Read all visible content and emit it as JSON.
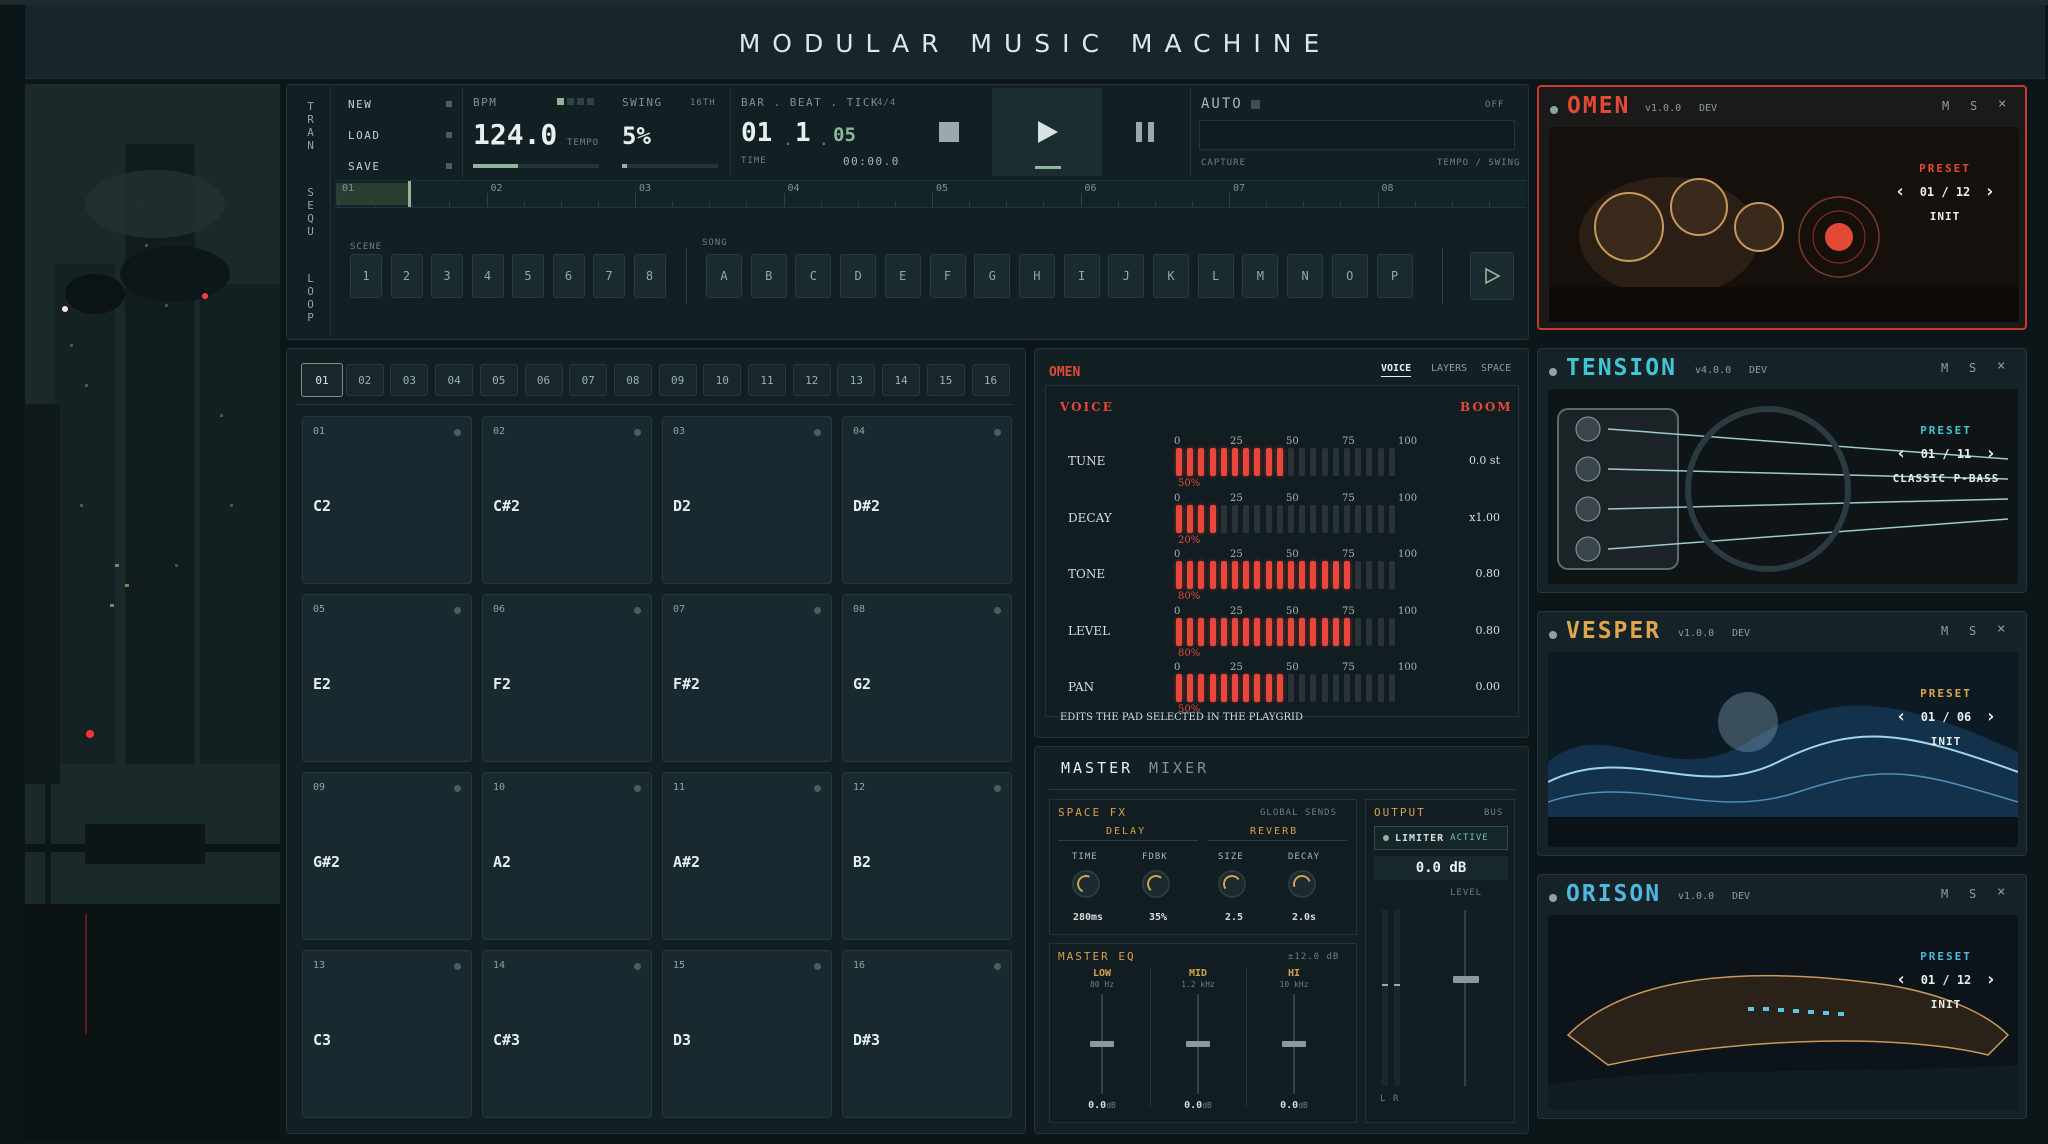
{
  "app": {
    "title": "MODULAR MUSIC MACHINE"
  },
  "side_labels": {
    "tran": "TRAN",
    "sequ": "SEQU",
    "loop": "LOOP"
  },
  "file_menu": [
    {
      "label": "NEW"
    },
    {
      "label": "LOAD"
    },
    {
      "label": "SAVE"
    }
  ],
  "tempo": {
    "label": "BPM",
    "value": "124.0",
    "sub_label": "TEMPO",
    "level": 0.36
  },
  "swing": {
    "label": "SWING",
    "division": "16TH",
    "value": "5%",
    "level": 0.05
  },
  "position": {
    "label": "BAR . BEAT . TICK",
    "signature": "4/4",
    "bar": "01",
    "beat": "1",
    "tick": "05",
    "time_label": "TIME",
    "time_value": "00:00.0"
  },
  "auto": {
    "label": "AUTO",
    "state": "OFF",
    "capture_label": "CAPTURE",
    "mode_label": "TEMPO / SWING"
  },
  "sequence_bars": [
    "01",
    "02",
    "03",
    "04",
    "05",
    "06",
    "07",
    "08"
  ],
  "scene": {
    "label": "SCENE",
    "items": [
      "1",
      "2",
      "3",
      "4",
      "5",
      "6",
      "7",
      "8"
    ]
  },
  "song": {
    "label": "SONG",
    "items": [
      "A",
      "B",
      "C",
      "D",
      "E",
      "F",
      "G",
      "H",
      "I",
      "J",
      "K",
      "L",
      "M",
      "N",
      "O",
      "P"
    ]
  },
  "pattern_tabs": [
    "01",
    "02",
    "03",
    "04",
    "05",
    "06",
    "07",
    "08",
    "09",
    "10",
    "11",
    "12",
    "13",
    "14",
    "15",
    "16"
  ],
  "selected_pattern": "01",
  "pads": [
    {
      "num": "01",
      "note": "C2"
    },
    {
      "num": "02",
      "note": "C#2"
    },
    {
      "num": "03",
      "note": "D2"
    },
    {
      "num": "04",
      "note": "D#2"
    },
    {
      "num": "05",
      "note": "E2"
    },
    {
      "num": "06",
      "note": "F2"
    },
    {
      "num": "07",
      "note": "F#2"
    },
    {
      "num": "08",
      "note": "G2"
    },
    {
      "num": "09",
      "note": "G#2"
    },
    {
      "num": "10",
      "note": "A2"
    },
    {
      "num": "11",
      "note": "A#2"
    },
    {
      "num": "12",
      "note": "B2"
    },
    {
      "num": "13",
      "note": "C3"
    },
    {
      "num": "14",
      "note": "C#3"
    },
    {
      "num": "15",
      "note": "D3"
    },
    {
      "num": "16",
      "note": "D#3"
    }
  ],
  "voice_panel": {
    "instrument": "OMEN",
    "tabs": [
      "VOICE",
      "LAYERS",
      "SPACE"
    ],
    "active_tab": "VOICE",
    "section_left": "VOICE",
    "section_right": "BOOM",
    "scale": [
      "0",
      "25",
      "50",
      "75",
      "100"
    ],
    "rows": [
      {
        "label": "TUNE",
        "pct": "50%",
        "level": 0.5,
        "value": "0.0 st"
      },
      {
        "label": "DECAY",
        "pct": "20%",
        "level": 0.2,
        "value": "x1.00"
      },
      {
        "label": "TONE",
        "pct": "80%",
        "level": 0.8,
        "value": "0.80"
      },
      {
        "label": "LEVEL",
        "pct": "80%",
        "level": 0.8,
        "value": "0.80"
      },
      {
        "label": "PAN",
        "pct": "50%",
        "level": 0.5,
        "value": "0.00"
      }
    ],
    "footnote": "EDITS THE PAD SELECTED IN THE PLAYGRID"
  },
  "master": {
    "tabs": [
      "MASTER",
      "MIXER"
    ],
    "space_fx": {
      "label": "SPACE FX",
      "sends": "GLOBAL SENDS",
      "delay": "DELAY",
      "reverb": "REVERB",
      "knobs": [
        {
          "label": "TIME",
          "value": "280ms"
        },
        {
          "label": "FDBK",
          "value": "35%"
        },
        {
          "label": "SIZE",
          "value": "2.5"
        },
        {
          "label": "DECAY",
          "value": "2.0s"
        }
      ]
    },
    "eq": {
      "label": "MASTER EQ",
      "range": "±12.0 dB",
      "bands": [
        {
          "label": "LOW",
          "freq": "80 Hz",
          "value": "0.0",
          "unit": "dB"
        },
        {
          "label": "MID",
          "freq": "1.2 kHz",
          "value": "0.0",
          "unit": "dB"
        },
        {
          "label": "HI",
          "freq": "10 kHz",
          "value": "0.0",
          "unit": "dB"
        }
      ]
    },
    "output": {
      "label": "OUTPUT",
      "bus": "BUS",
      "limiter": "LIMITER",
      "limiter_state": "ACTIVE",
      "level_db": "0.0 dB",
      "level_label": "LEVEL",
      "left": "L",
      "right": "R"
    }
  },
  "instruments": [
    {
      "name": "OMEN",
      "version": "v1.0.0",
      "tag": "DEV",
      "color": "#e24a36",
      "preset_label": "PRESET",
      "preset_index": "01 / 12",
      "preset_name": "INIT",
      "m": "M",
      "s": "S",
      "x": "×",
      "selected": true
    },
    {
      "name": "TENSION",
      "version": "v4.0.0",
      "tag": "DEV",
      "color": "#3fc7d4",
      "preset_label": "PRESET",
      "preset_index": "01 / 11",
      "preset_name": "CLASSIC P-BASS",
      "m": "M",
      "s": "S",
      "x": "×",
      "selected": false
    },
    {
      "name": "VESPER",
      "version": "v1.0.0",
      "tag": "DEV",
      "color": "#e2a64a",
      "preset_label": "PRESET",
      "preset_index": "01 / 06",
      "preset_name": "INIT",
      "m": "M",
      "s": "S",
      "x": "×",
      "selected": false
    },
    {
      "name": "ORISON",
      "version": "v1.0.0",
      "tag": "DEV",
      "color": "#4fb7e0",
      "preset_label": "PRESET",
      "preset_index": "01 / 12",
      "preset_name": "INIT",
      "m": "M",
      "s": "S",
      "x": "×",
      "selected": false
    }
  ],
  "colors": {
    "accent_red": "#e24a36",
    "meter_on": "#e8463a",
    "meter_off": "#2a3338",
    "bg": "#0c1518"
  }
}
